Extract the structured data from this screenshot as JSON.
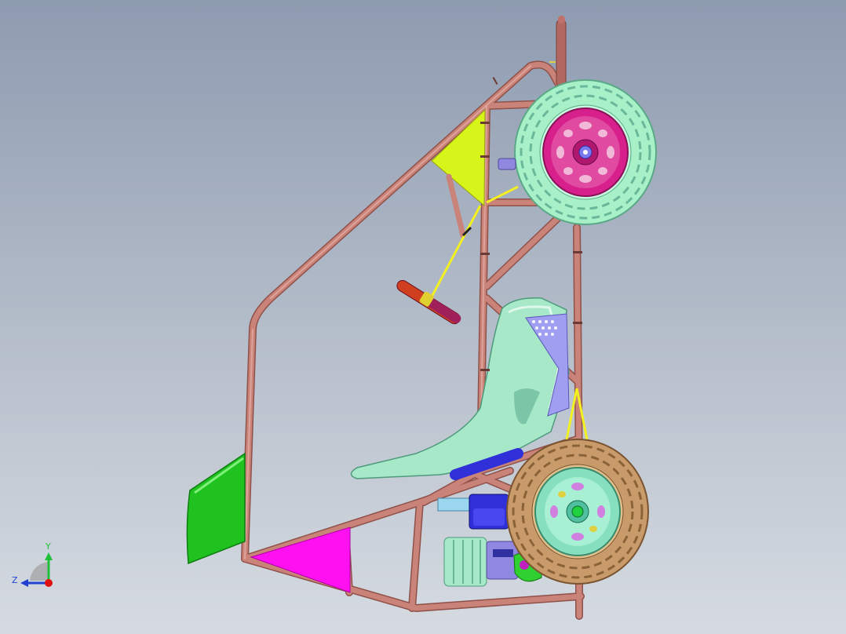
{
  "axis_triad": {
    "y_label": "Y",
    "z_label": "Z",
    "colors": {
      "y": "#1fbf3a",
      "z": "#2040d0",
      "x": "#e01010"
    }
  },
  "colors": {
    "tube": "#c98378",
    "tube_dark": "#8f514a",
    "gusset_yellow": "#d7f51a",
    "gusset_magenta": "#ff10f0",
    "nose_green": "#1fc21f",
    "seat": "#a6e8c8",
    "tire_front": "#a8f0c8",
    "tire_rear": "#c99b6a",
    "rim_front": "#d8208c",
    "rim_rear": "#86e0c0",
    "engine_blue": "#3030d8",
    "tank_purple": "#9088e0",
    "axle_cyan": "#9ad6ee",
    "strap_yellow": "#f2f020"
  }
}
